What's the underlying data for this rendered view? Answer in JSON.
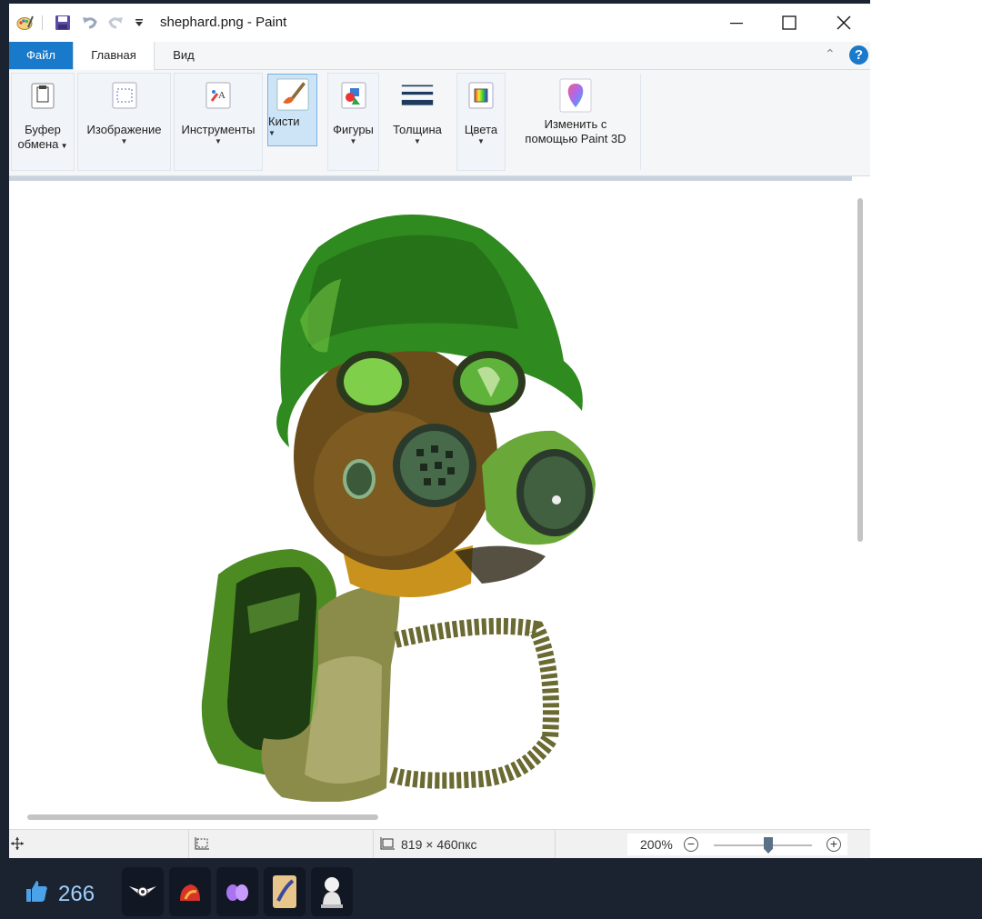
{
  "window": {
    "title": "shephard.png - Paint"
  },
  "menu": {
    "tabs": [
      {
        "label": "Файл"
      },
      {
        "label": "Главная"
      },
      {
        "label": "Вид"
      }
    ],
    "help_label": "?"
  },
  "ribbon": {
    "groups": [
      {
        "label_line1": "Буфер",
        "label_line2": "обмена"
      },
      {
        "label_line1": "Изображение"
      },
      {
        "label_line1": "Инструменты"
      },
      {
        "label_line1": "Кисти"
      },
      {
        "label_line1": "Фигуры"
      },
      {
        "label_line1": "Толщина"
      },
      {
        "label_line1": "Цвета"
      },
      {
        "label_line1": "Изменить с",
        "label_line2": "помощью Paint 3D"
      }
    ]
  },
  "status": {
    "image_size": "819 × 460пкс",
    "zoom": "200%",
    "zoom_level_percent": 200
  },
  "bottom_bar": {
    "like_count": "266"
  },
  "colors": {
    "file_tab": "#1979ca",
    "bottom_bar": "#1b2230",
    "helmet_green": "#2f8a1f",
    "mask_brown": "#6b4d1c",
    "lens_green": "#7fcf4a"
  }
}
